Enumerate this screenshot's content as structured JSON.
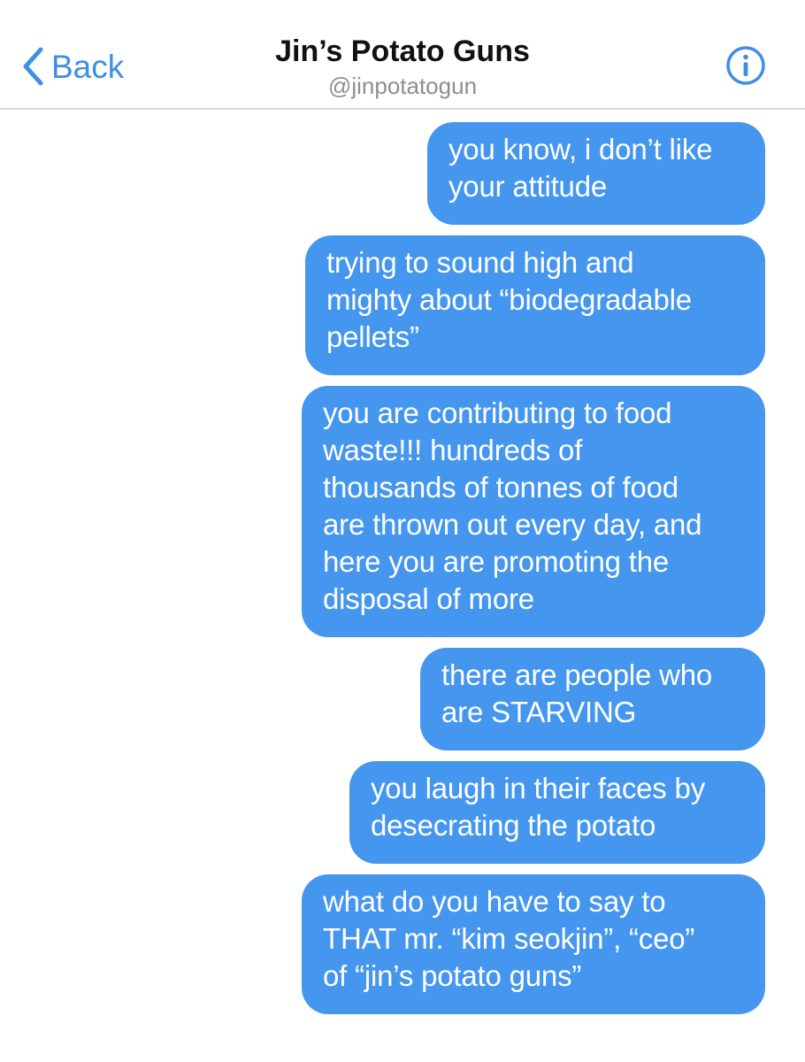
{
  "header": {
    "back_label": "Back",
    "title": "Jin’s Potato Guns",
    "handle": "@jinpotatogun",
    "back_icon": "chevron-left-icon",
    "info_icon": "info-circle-icon",
    "accent_color": "#3f8ee6"
  },
  "messages": [
    {
      "direction": "outgoing",
      "text": "you know, i don’t like\nyour attitude"
    },
    {
      "direction": "outgoing",
      "text": "trying to sound high and\nmighty about “biodegradable\npellets”"
    },
    {
      "direction": "outgoing",
      "text": "you are contributing to food\nwaste!!! hundreds of\nthousands of tonnes of food\nare thrown out every day, and\nhere you are promoting the\ndisposal of more"
    },
    {
      "direction": "outgoing",
      "text": "there are people who\nare STARVING"
    },
    {
      "direction": "outgoing",
      "text": "you laugh in their faces by\ndesecrating the potato"
    },
    {
      "direction": "outgoing",
      "text": "what do you have to say to\nTHAT mr. “kim seokjin”, “ceo”\nof “jin’s potato guns”"
    }
  ],
  "colors": {
    "bubble_outgoing": "#4496ee",
    "bubble_text": "#ffffff",
    "divider": "#d6d6da",
    "handle_text": "#8e8e93"
  }
}
